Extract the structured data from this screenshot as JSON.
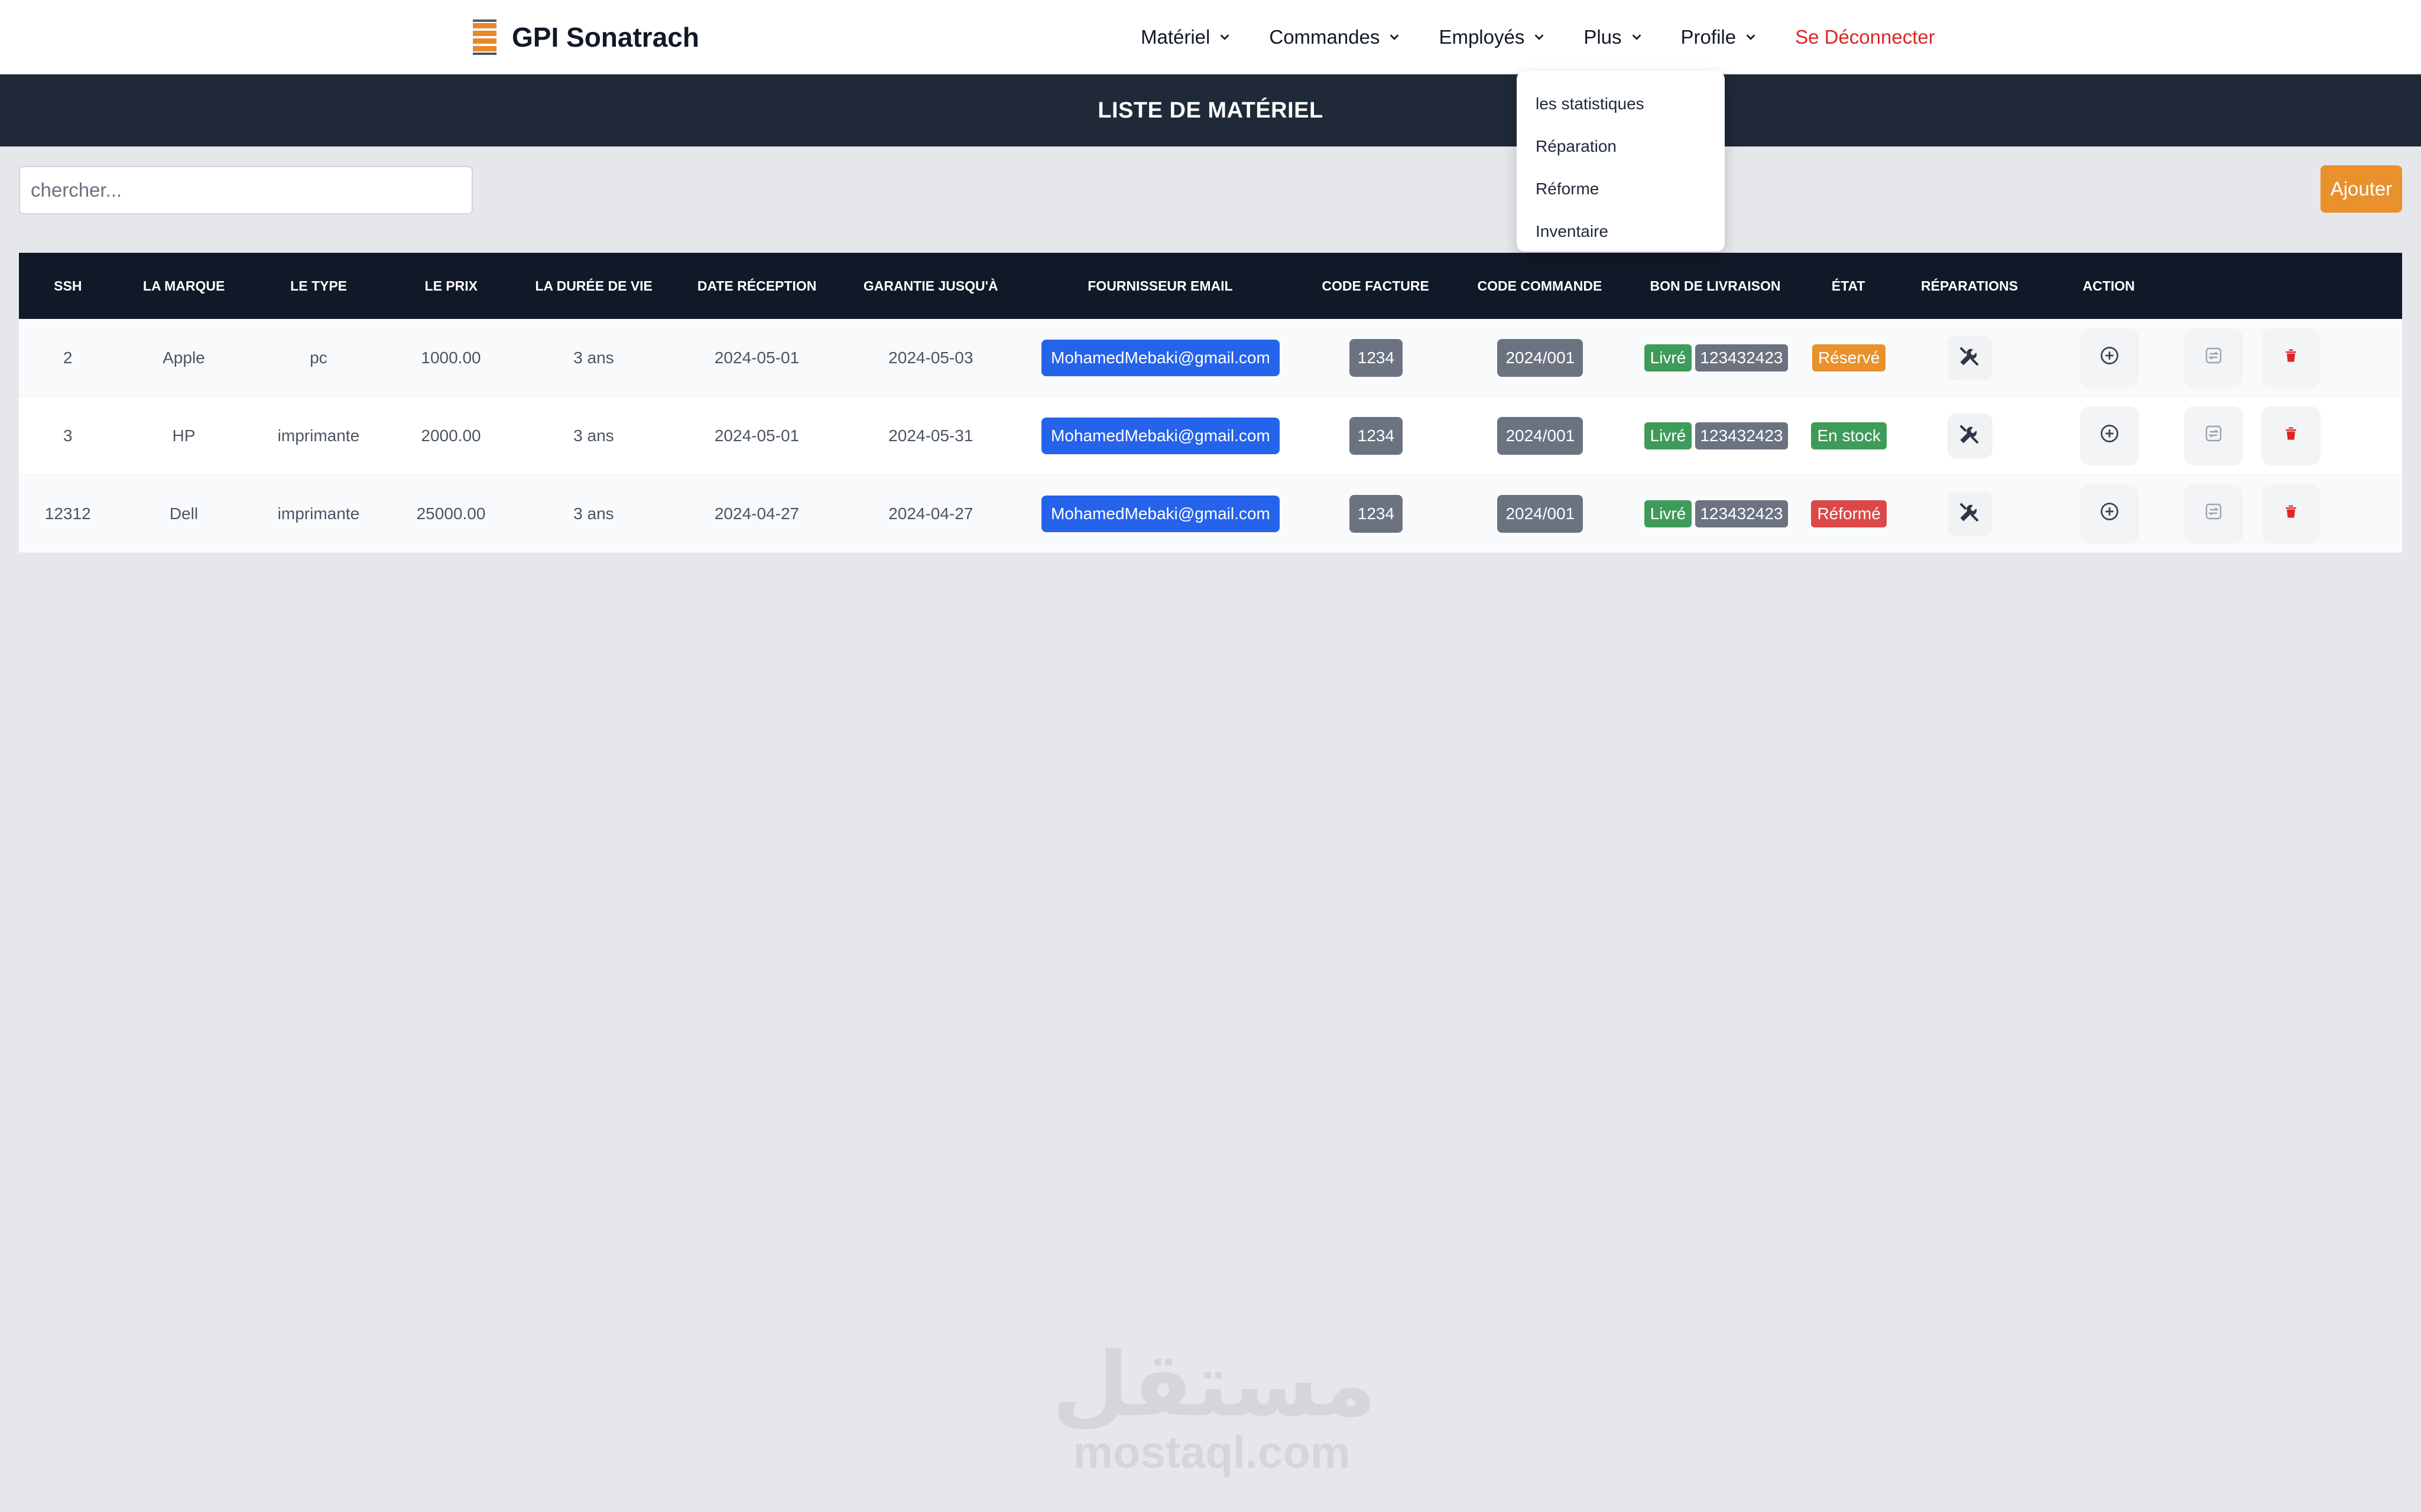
{
  "brand": {
    "name": "GPI Sonatrach"
  },
  "nav": {
    "items": [
      {
        "label": "Matériel"
      },
      {
        "label": "Commandes"
      },
      {
        "label": "Employés"
      },
      {
        "label": "Plus"
      },
      {
        "label": "Profile"
      }
    ],
    "logout": "Se Déconnecter"
  },
  "dropdown": {
    "items": [
      "les statistiques",
      "Réparation",
      "Réforme",
      "Inventaire"
    ]
  },
  "page": {
    "title": "LISTE DE MATÉRIEL"
  },
  "search": {
    "placeholder": "chercher..."
  },
  "toolbar": {
    "add_label": "Ajouter"
  },
  "table": {
    "headers": [
      "SSH",
      "LA MARQUE",
      "LE TYPE",
      "LE PRIX",
      "LA DURÉE DE VIE",
      "DATE RÉCEPTION",
      "GARANTIE JUSQU'À",
      "FOURNISSEUR EMAIL",
      "CODE FACTURE",
      "CODE COMMANDE",
      "BON DE LIVRAISON",
      "ÉTAT",
      "RÉPARATIONS",
      "ACTION"
    ],
    "rows": [
      {
        "ssh": "2",
        "marque": "Apple",
        "type": "pc",
        "prix": "1000.00",
        "duree": "3 ans",
        "reception": "2024-05-01",
        "garantie": "2024-05-03",
        "email": "MohamedMebaki@gmail.com",
        "facture": "1234",
        "commande": "2024/001",
        "livraison_status": "Livré",
        "livraison_code": "123432423",
        "etat": "Réservé",
        "etat_color": "#e8912d"
      },
      {
        "ssh": "3",
        "marque": "HP",
        "type": "imprimante",
        "prix": "2000.00",
        "duree": "3 ans",
        "reception": "2024-05-01",
        "garantie": "2024-05-31",
        "email": "MohamedMebaki@gmail.com",
        "facture": "1234",
        "commande": "2024/001",
        "livraison_status": "Livré",
        "livraison_code": "123432423",
        "etat": "En stock",
        "etat_color": "#3f9b5a"
      },
      {
        "ssh": "12312",
        "marque": "Dell",
        "type": "imprimante",
        "prix": "25000.00",
        "duree": "3 ans",
        "reception": "2024-04-27",
        "garantie": "2024-04-27",
        "email": "MohamedMebaki@gmail.com",
        "facture": "1234",
        "commande": "2024/001",
        "livraison_status": "Livré",
        "livraison_code": "123432423",
        "etat": "Réformé",
        "etat_color": "#dc4848"
      }
    ]
  },
  "watermark": {
    "arabic": "مستقل",
    "latin": "mostaql.com"
  },
  "icons": {
    "repair": "tools-icon",
    "add": "plus-circle-icon",
    "transfer": "transfer-icon",
    "delete": "trash-icon",
    "chevron": "chevron-down-icon"
  }
}
